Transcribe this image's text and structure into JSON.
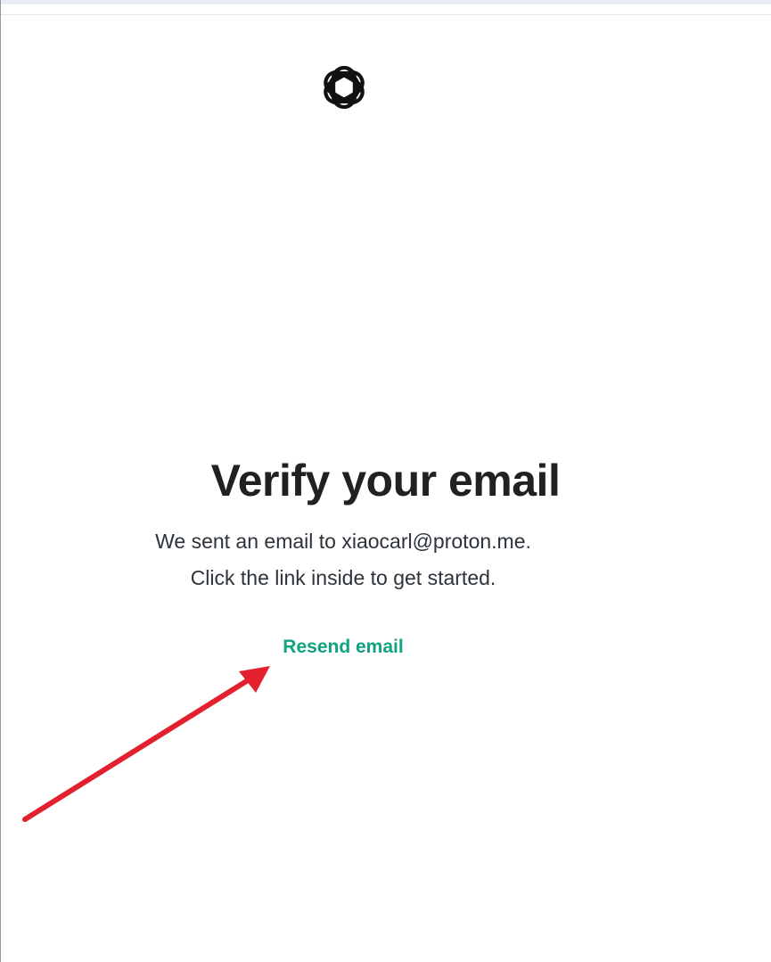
{
  "page": {
    "title": "Verify your email",
    "message_line1": "We sent an email to xiaocarl@proton.me.",
    "message_line2": "Click the link inside to get started.",
    "resend_label": "Resend email"
  },
  "icons": {
    "logo": "openai-logo-icon",
    "annotation": "red-arrow-icon"
  },
  "colors": {
    "accent": "#10a37f",
    "title": "#202123",
    "text": "#2d333a",
    "arrow": "#e3202d"
  }
}
